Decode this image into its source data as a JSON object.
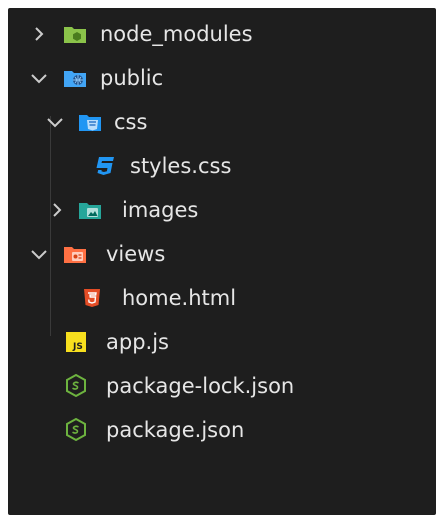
{
  "explorer": {
    "items": [
      {
        "label": "node_modules",
        "type": "folder",
        "state": "collapsed",
        "icon": "folder-green-icon",
        "depth": 0
      },
      {
        "label": "public",
        "type": "folder",
        "state": "expanded",
        "icon": "folder-public-globe-icon",
        "depth": 0
      },
      {
        "label": "css",
        "type": "folder",
        "state": "expanded",
        "icon": "folder-css-icon",
        "depth": 1
      },
      {
        "label": "styles.css",
        "type": "file",
        "icon": "css3-file-icon",
        "depth": 2
      },
      {
        "label": "images",
        "type": "folder",
        "state": "collapsed",
        "icon": "folder-images-icon",
        "depth": 1
      },
      {
        "label": "views",
        "type": "folder",
        "state": "expanded",
        "icon": "folder-views-icon",
        "depth": 0
      },
      {
        "label": "home.html",
        "type": "file",
        "icon": "html5-file-icon",
        "depth": 1
      },
      {
        "label": "app.js",
        "type": "file",
        "icon": "javascript-file-icon",
        "depth": 0
      },
      {
        "label": "package-lock.json",
        "type": "file",
        "icon": "nodejs-file-icon",
        "depth": 0
      },
      {
        "label": "package.json",
        "type": "file",
        "icon": "nodejs-file-icon",
        "depth": 0
      }
    ]
  },
  "colors": {
    "background": "#1e1e1e",
    "text": "#e6e6e6",
    "node_green": "#8bc34a",
    "public_blue": "#42a5f5",
    "css_blue": "#2196f3",
    "images_teal": "#26a69a",
    "views_red": "#ff7043",
    "html_orange": "#e44d26",
    "js_yellow": "#f7df1e",
    "npm_green": "#6db33f"
  }
}
